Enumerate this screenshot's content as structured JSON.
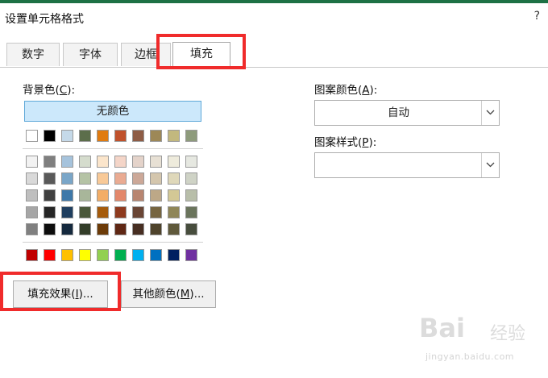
{
  "window": {
    "title": "设置单元格格式",
    "help": "?"
  },
  "tabs": [
    {
      "label": "数字"
    },
    {
      "label": "字体"
    },
    {
      "label": "边框"
    },
    {
      "label": "填充"
    }
  ],
  "fill": {
    "background_label": "背景色(",
    "background_key": "C",
    "background_suffix": "):",
    "no_color": "无颜色",
    "fill_effects_label": "填充效果(",
    "fill_effects_key": "I",
    "fill_effects_suffix": ")...",
    "more_colors_label": "其他颜色(",
    "more_colors_key": "M",
    "more_colors_suffix": ")...",
    "theme_row": [
      "#ffffff",
      "#000000",
      "#c5d9e9",
      "#5c6e4b",
      "#e07b10",
      "#c0512b",
      "#8e5c45",
      "#9d8857",
      "#c2b87e",
      "#8e9b7c"
    ],
    "tint_rows": [
      [
        "#f2f2f2",
        "#7f7f7f",
        "#a6c3dc",
        "#d5dccd",
        "#fbe5cb",
        "#f4d5c8",
        "#e4d3ca",
        "#e7e0d4",
        "#eeebdc",
        "#e6e8e1"
      ],
      [
        "#d9d9d9",
        "#595959",
        "#7aa6c8",
        "#b5c3a5",
        "#f8c997",
        "#eaab92",
        "#cca898",
        "#d4c6ad",
        "#dfd8ba",
        "#cfd3c6"
      ],
      [
        "#bfbfbf",
        "#404040",
        "#3e78a9",
        "#a8b69a",
        "#f3ad66",
        "#e3876a",
        "#b88570",
        "#bda887",
        "#d3c895",
        "#b8bea9"
      ],
      [
        "#a6a6a6",
        "#262626",
        "#1f3e5f",
        "#4a583b",
        "#a55b0c",
        "#8e3a1e",
        "#6a4534",
        "#766540",
        "#8f8658",
        "#6a745c"
      ],
      [
        "#808080",
        "#0d0d0d",
        "#15293e",
        "#333d29",
        "#6c3b08",
        "#5f2714",
        "#472e22",
        "#4e432b",
        "#5f593b",
        "#474d3d"
      ]
    ],
    "standard_row": [
      "#c00000",
      "#ff0000",
      "#ffc000",
      "#ffff00",
      "#92d050",
      "#00b050",
      "#00b0f0",
      "#0070c0",
      "#002060",
      "#7030a0"
    ]
  },
  "pattern": {
    "color_label": "图案颜色(",
    "color_key": "A",
    "color_suffix": "):",
    "color_value": "自动",
    "style_label": "图案样式(",
    "style_key": "P",
    "style_suffix": "):",
    "style_value": ""
  },
  "watermark": {
    "logo": "Bai",
    "cn": "经验",
    "url": "jingyan.baidu.com"
  }
}
